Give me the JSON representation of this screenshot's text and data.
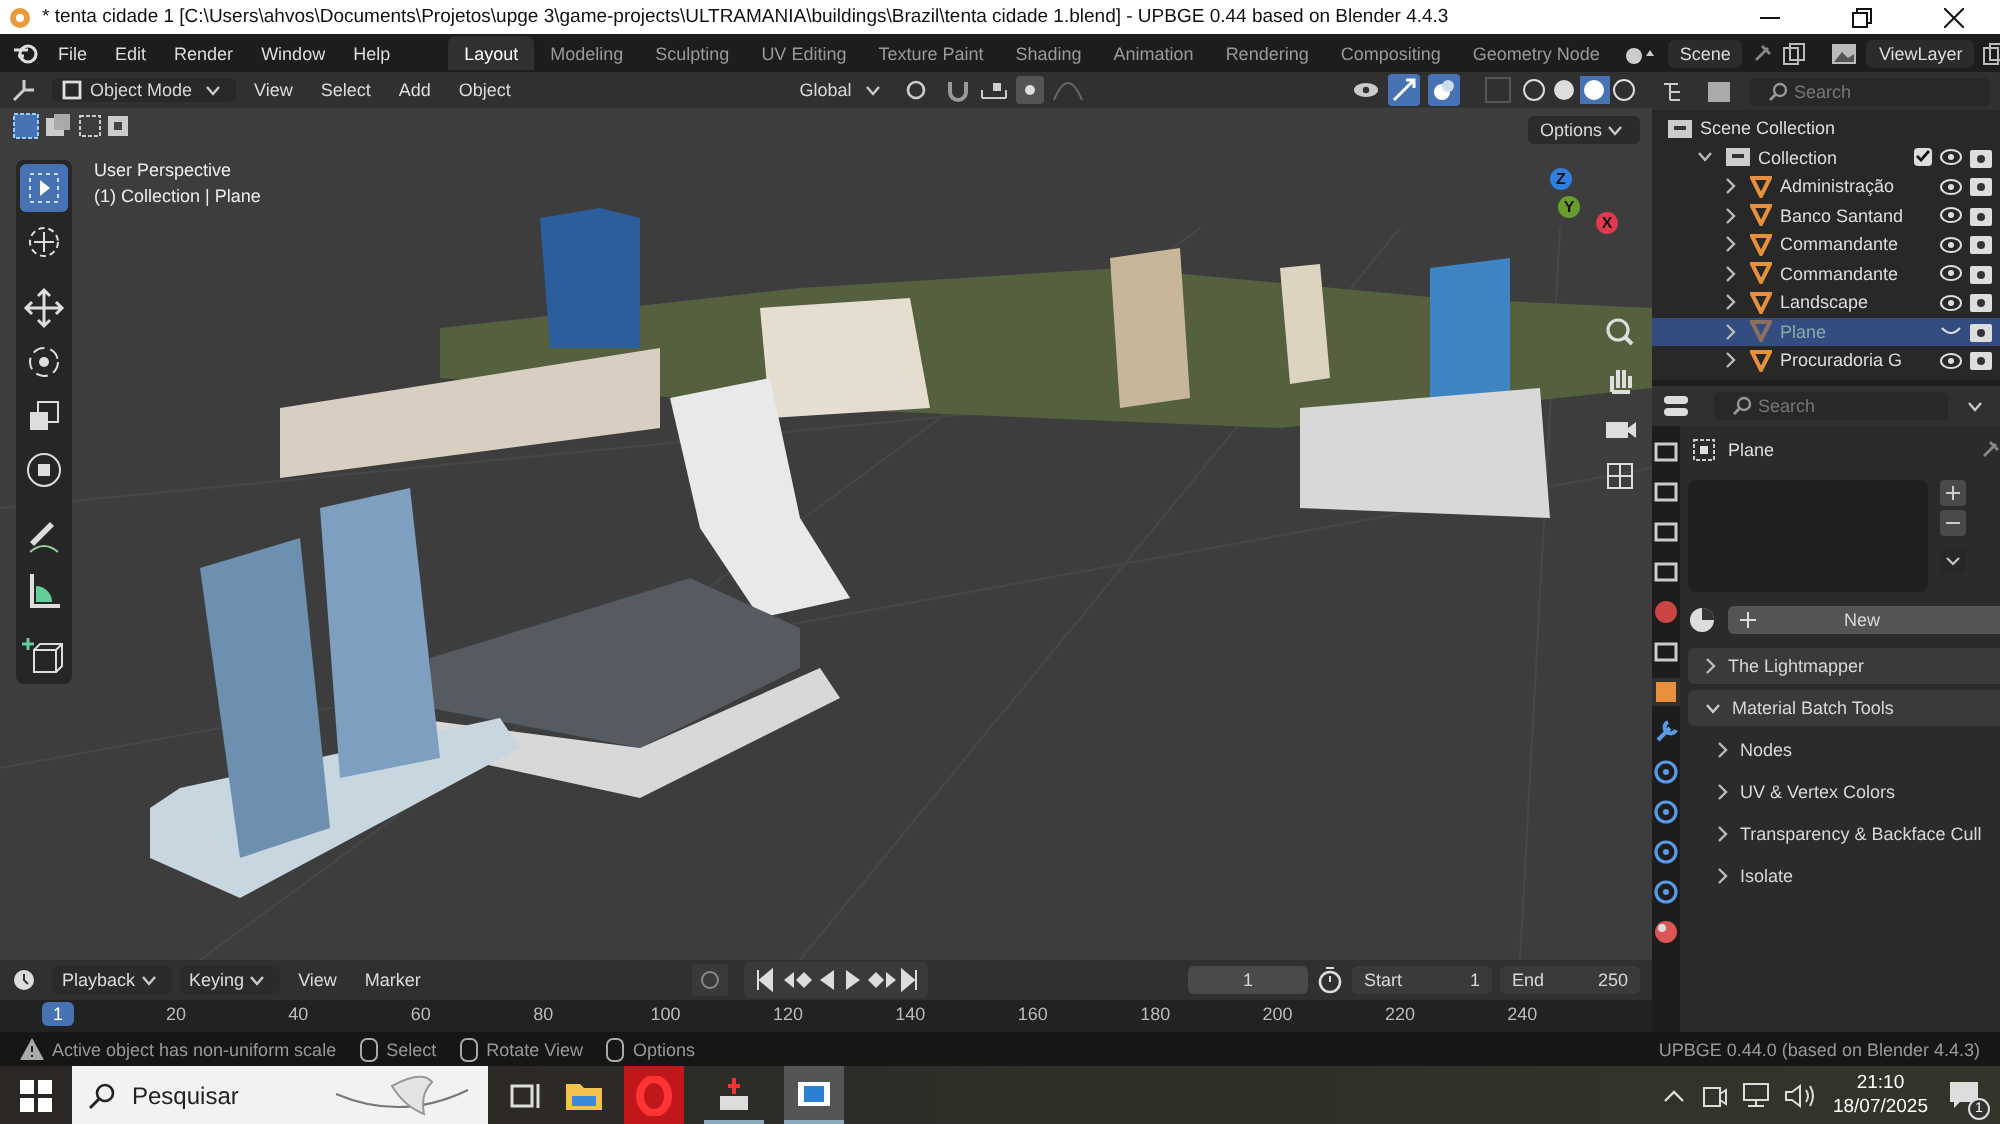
{
  "window": {
    "title": "* tenta cidade 1 [C:\\Users\\ahvos\\Documents\\Projetos\\upge 3\\game-projects\\ULTRAMANIA\\buildings\\Brazil\\tenta cidade 1.blend] - UPBGE 0.44 based on Blender 4.4.3"
  },
  "menu": [
    "File",
    "Edit",
    "Render",
    "Window",
    "Help"
  ],
  "workspaces": [
    {
      "label": "Layout",
      "selected": true
    },
    {
      "label": "Modeling",
      "selected": false
    },
    {
      "label": "Sculpting",
      "selected": false
    },
    {
      "label": "UV Editing",
      "selected": false
    },
    {
      "label": "Texture Paint",
      "selected": false
    },
    {
      "label": "Shading",
      "selected": false
    },
    {
      "label": "Animation",
      "selected": false
    },
    {
      "label": "Rendering",
      "selected": false
    },
    {
      "label": "Compositing",
      "selected": false
    },
    {
      "label": "Geometry Node",
      "selected": false
    }
  ],
  "scene": "Scene",
  "view_layer": "ViewLayer",
  "viewport": {
    "mode": "Object Mode",
    "menus": [
      "View",
      "Select",
      "Add",
      "Object"
    ],
    "orientation": "Global",
    "info": [
      "User Perspective",
      "(1) Collection | Plane"
    ],
    "options": "Options",
    "axes": [
      "Z",
      "Y",
      "X"
    ]
  },
  "outliner": {
    "search_placeholder": "Search",
    "root": "Scene Collection",
    "collection": {
      "label": "Collection",
      "expanded": true,
      "checked": true,
      "children": [
        {
          "label": "Administração",
          "selected": false,
          "visible": true
        },
        {
          "label": "Banco Santand",
          "selected": false,
          "visible": true
        },
        {
          "label": "Commandante",
          "selected": false,
          "visible": true
        },
        {
          "label": "Commandante",
          "selected": false,
          "visible": true
        },
        {
          "label": "Landscape",
          "selected": false,
          "visible": true
        },
        {
          "label": "Plane",
          "selected": true,
          "visible": false
        },
        {
          "label": "Procuradoria G",
          "selected": false,
          "visible": true
        }
      ]
    }
  },
  "properties": {
    "search_placeholder": "Search",
    "object": "Plane",
    "new_button": "New",
    "panels": [
      {
        "label": "The Lightmapper",
        "expanded": false
      },
      {
        "label": "Material Batch Tools",
        "expanded": true,
        "children": [
          {
            "label": "Nodes"
          },
          {
            "label": "UV & Vertex Colors"
          },
          {
            "label": "Transparency & Backface Cull"
          },
          {
            "label": "Isolate"
          }
        ]
      }
    ]
  },
  "timeline": {
    "menus": [
      "Playback",
      "Keying",
      "View",
      "Marker"
    ],
    "current_frame": "1",
    "start_label": "Start",
    "start": "1",
    "end_label": "End",
    "end": "250",
    "ruler": [
      {
        "label": "1",
        "selected": true
      },
      {
        "label": "20",
        "selected": false
      },
      {
        "label": "40",
        "selected": false
      },
      {
        "label": "60",
        "selected": false
      },
      {
        "label": "80",
        "selected": false
      },
      {
        "label": "100",
        "selected": false
      },
      {
        "label": "120",
        "selected": false
      },
      {
        "label": "140",
        "selected": false
      },
      {
        "label": "160",
        "selected": false
      },
      {
        "label": "180",
        "selected": false
      },
      {
        "label": "200",
        "selected": false
      },
      {
        "label": "220",
        "selected": false
      },
      {
        "label": "240",
        "selected": false
      }
    ]
  },
  "status_bar": {
    "warning": "Active object has non-uniform scale",
    "hints": [
      "Select",
      "Rotate View",
      "Options"
    ],
    "version": "UPBGE 0.44.0 (based on Blender 4.4.3)"
  },
  "taskbar": {
    "search_placeholder": "Pesquisar",
    "time": "21:10",
    "date": "18/07/2025",
    "notifications": "1"
  }
}
